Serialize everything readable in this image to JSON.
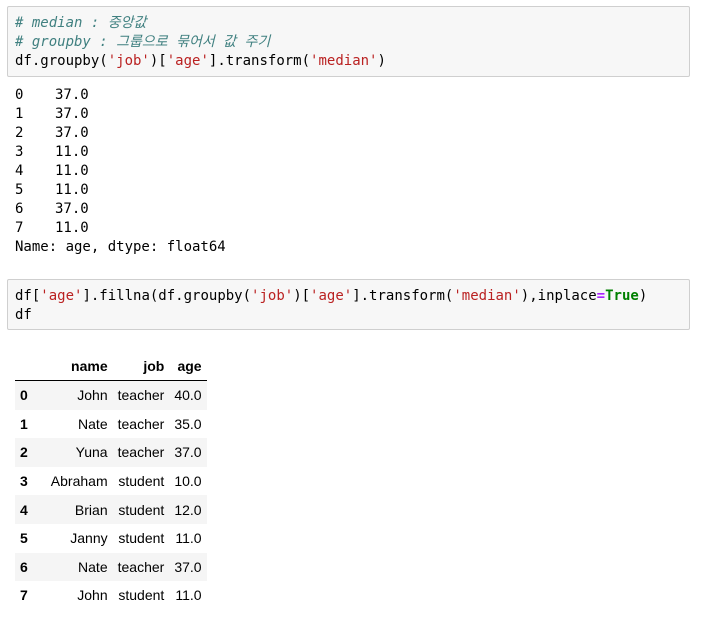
{
  "cell1": {
    "lines": [
      {
        "type": "comment",
        "text": "# median : 중앙값"
      },
      {
        "type": "comment",
        "text": "# groupby : 그룹으로 묶어서 값 주기"
      }
    ],
    "code": {
      "prefix": "df.groupby(",
      "s1": "'job'",
      "mid": ")[",
      "s2": "'age'",
      "mid2": "].transform(",
      "s3": "'median'",
      "suffix": ")"
    }
  },
  "output1": {
    "rows": [
      {
        "idx": "0",
        "val": "37.0"
      },
      {
        "idx": "1",
        "val": "37.0"
      },
      {
        "idx": "2",
        "val": "37.0"
      },
      {
        "idx": "3",
        "val": "11.0"
      },
      {
        "idx": "4",
        "val": "11.0"
      },
      {
        "idx": "5",
        "val": "11.0"
      },
      {
        "idx": "6",
        "val": "37.0"
      },
      {
        "idx": "7",
        "val": "11.0"
      }
    ],
    "footer": "Name: age, dtype: float64"
  },
  "cell2": {
    "line1": {
      "a": "df[",
      "s1": "'age'",
      "b": "].fillna(df.groupby(",
      "s2": "'job'",
      "c": ")[",
      "s3": "'age'",
      "d": "].transform(",
      "s4": "'median'",
      "e": "),inplace",
      "eq": "=",
      "kw": "True",
      "f": ")"
    },
    "line2": "df"
  },
  "dataframe": {
    "columns": [
      "name",
      "job",
      "age"
    ],
    "rows": [
      {
        "index": "0",
        "name": "John",
        "job": "teacher",
        "age": "40.0"
      },
      {
        "index": "1",
        "name": "Nate",
        "job": "teacher",
        "age": "35.0"
      },
      {
        "index": "2",
        "name": "Yuna",
        "job": "teacher",
        "age": "37.0"
      },
      {
        "index": "3",
        "name": "Abraham",
        "job": "student",
        "age": "10.0"
      },
      {
        "index": "4",
        "name": "Brian",
        "job": "student",
        "age": "12.0"
      },
      {
        "index": "5",
        "name": "Janny",
        "job": "student",
        "age": "11.0"
      },
      {
        "index": "6",
        "name": "Nate",
        "job": "teacher",
        "age": "37.0"
      },
      {
        "index": "7",
        "name": "John",
        "job": "student",
        "age": "11.0"
      }
    ]
  }
}
